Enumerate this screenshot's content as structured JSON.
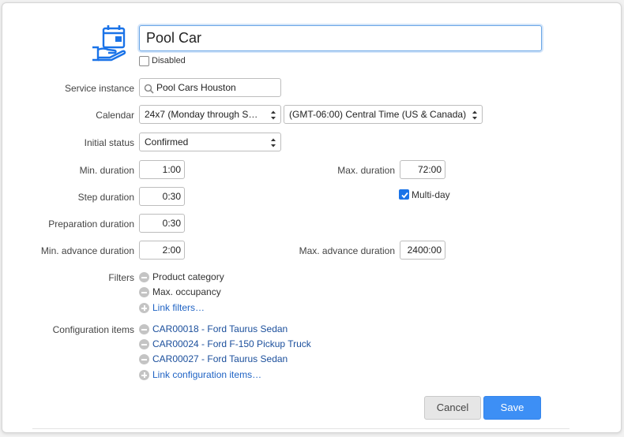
{
  "header": {
    "name_value": "Pool Car",
    "disabled_label": "Disabled",
    "disabled_checked": false,
    "icon": "calendar-hand-icon",
    "accent_color": "#1a73e8"
  },
  "form": {
    "service_instance": {
      "label": "Service instance",
      "value": "Pool Cars Houston",
      "icon": "search-icon"
    },
    "calendar": {
      "label": "Calendar",
      "value": "24x7 (Monday through S…",
      "timezone": "(GMT-06:00) Central Time (US & Canada)"
    },
    "initial_status": {
      "label": "Initial status",
      "value": "Confirmed"
    },
    "min_duration": {
      "label": "Min. duration",
      "value": "1:00"
    },
    "max_duration": {
      "label": "Max. duration",
      "value": "72:00"
    },
    "step_duration": {
      "label": "Step duration",
      "value": "0:30"
    },
    "multi_day": {
      "label": "Multi-day",
      "checked": true
    },
    "preparation_duration": {
      "label": "Preparation duration",
      "value": "0:30"
    },
    "min_advance_duration": {
      "label": "Min. advance duration",
      "value": "2:00"
    },
    "max_advance_duration": {
      "label": "Max. advance duration",
      "value": "2400:00"
    },
    "filters": {
      "label": "Filters",
      "items": [
        "Product category",
        "Max. occupancy"
      ],
      "link_label": "Link filters…"
    },
    "configuration_items": {
      "label": "Configuration items",
      "items": [
        "CAR00018 - Ford Taurus Sedan",
        "CAR00024 - Ford F-150 Pickup Truck",
        "CAR00027 - Ford Taurus Sedan"
      ],
      "link_label": "Link configuration items…"
    }
  },
  "actions": {
    "cancel_label": "Cancel",
    "save_label": "Save"
  }
}
